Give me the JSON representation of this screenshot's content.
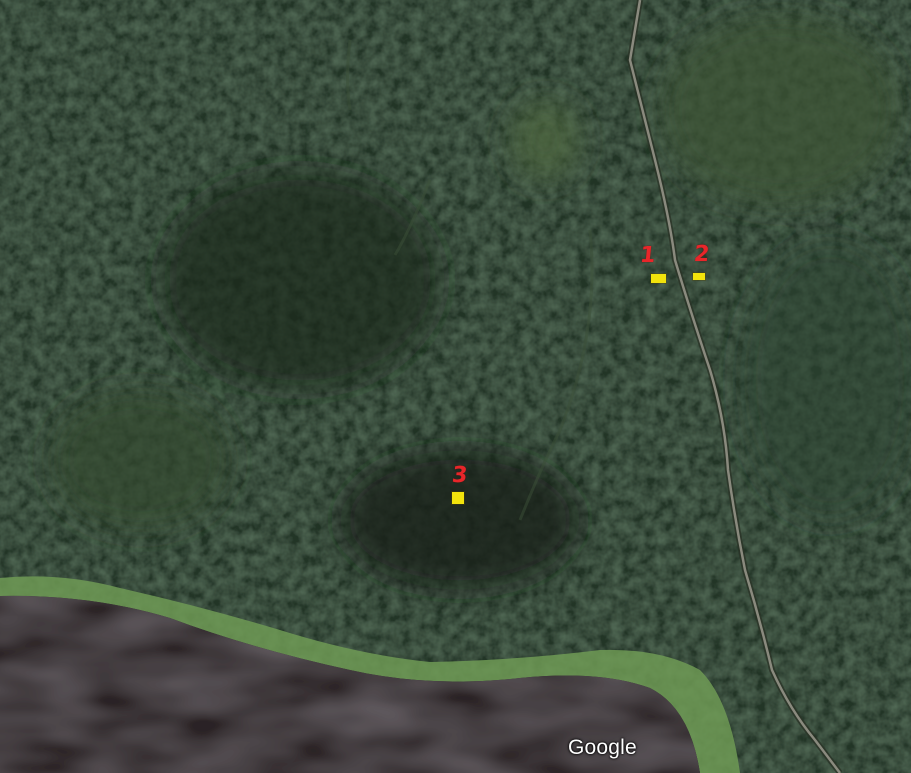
{
  "map": {
    "type": "satellite",
    "attribution": "Google",
    "colors": {
      "forest_dark": "#1b2a1d",
      "forest_mid": "#2a3d2a",
      "clearing": "#4f6a3e",
      "shoreline": "#6f9a55",
      "water": "#2c2426",
      "road": "#8a8a7e",
      "marker": "#f2e30c",
      "label": "#e8262a"
    }
  },
  "markers": [
    {
      "label": "1",
      "icon": "yellow-rectangle-marker"
    },
    {
      "label": "2",
      "icon": "yellow-rectangle-marker"
    },
    {
      "label": "3",
      "icon": "yellow-rectangle-marker"
    }
  ]
}
